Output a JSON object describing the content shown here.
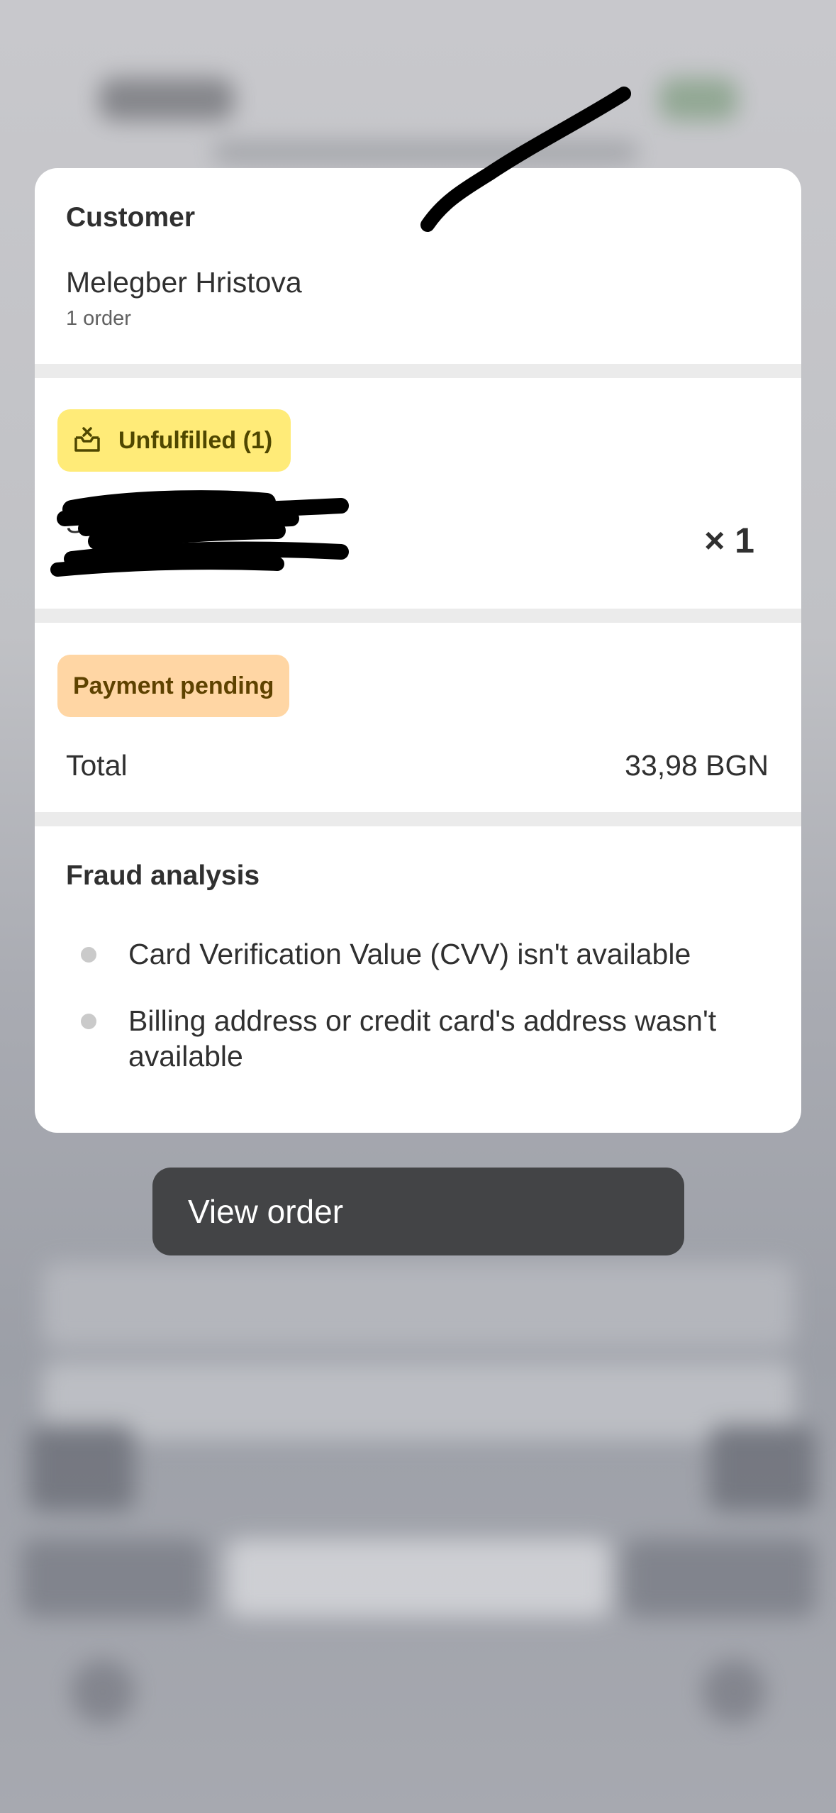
{
  "customer": {
    "heading": "Customer",
    "name": "Melegber Hristova",
    "orders": "1 order"
  },
  "fulfillment": {
    "badge": "Unfulfilled (1)",
    "icon": "box-x-icon",
    "line_title": "S",
    "line_subtitle": "",
    "quantity": "× 1"
  },
  "payment": {
    "badge": "Payment pending",
    "total_label": "Total",
    "total_value": "33,98 BGN"
  },
  "fraud": {
    "heading": "Fraud analysis",
    "items": [
      "Card Verification Value (CVV) isn't available",
      "Billing address or credit card's address wasn't available"
    ]
  },
  "action": {
    "view_order": "View order"
  },
  "colors": {
    "unfulfilled_badge": "#ffeb78",
    "payment_badge": "#ffd6a4",
    "action_button": "#434446"
  }
}
